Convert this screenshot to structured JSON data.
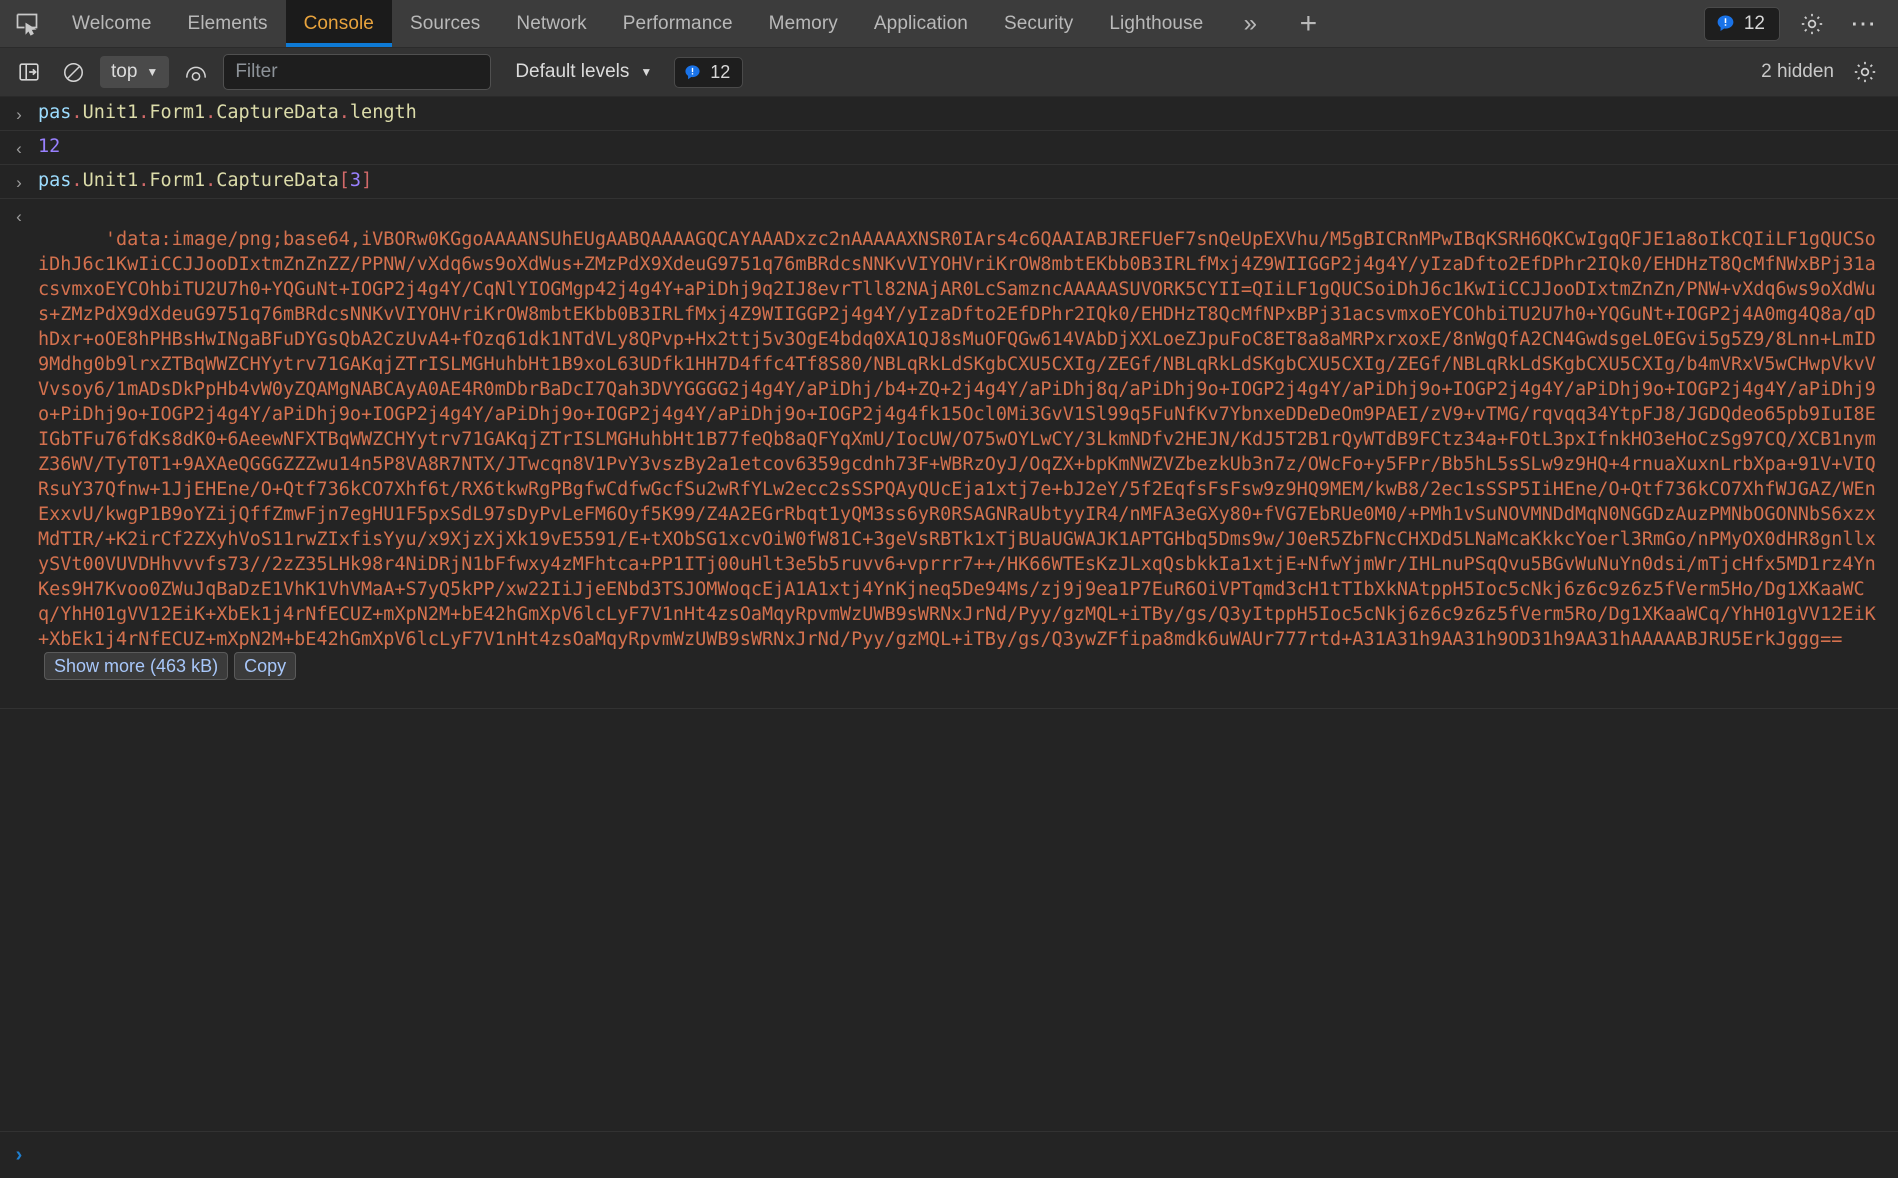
{
  "tabbar": {
    "inspect_icon": "inspect-element-icon",
    "tabs": [
      {
        "label": "Welcome",
        "selected": false
      },
      {
        "label": "Elements",
        "selected": false
      },
      {
        "label": "Console",
        "selected": true
      },
      {
        "label": "Sources",
        "selected": false
      },
      {
        "label": "Network",
        "selected": false
      },
      {
        "label": "Performance",
        "selected": false
      },
      {
        "label": "Memory",
        "selected": false
      },
      {
        "label": "Application",
        "selected": false
      },
      {
        "label": "Security",
        "selected": false
      },
      {
        "label": "Lighthouse",
        "selected": false
      }
    ],
    "more_tabs_label": "»",
    "add_tab_label": "+",
    "issues_count": "12",
    "settings_icon": "gear-icon",
    "more_options_icon": "dots-horizontal-icon",
    "accent_selected_tab": "#e8a33d",
    "accent_underline": "#0e7ad5"
  },
  "console_toolbar": {
    "sidebar_toggle_icon": "sidebar-toggle-icon",
    "clear_console_icon": "clear-console-icon",
    "context_selector": "top",
    "live_expression_icon": "eye-icon",
    "filter_placeholder": "Filter",
    "filter_value": "",
    "levels_label": "Default levels",
    "issues_count": "12",
    "hidden_label": "2 hidden",
    "settings_icon": "gear-icon"
  },
  "console": {
    "entries": [
      {
        "kind": "command",
        "gutter": "›",
        "tokens": [
          {
            "t": "ident",
            "v": "pas"
          },
          {
            "t": "dot",
            "v": "."
          },
          {
            "t": "prop",
            "v": "Unit1"
          },
          {
            "t": "dot",
            "v": "."
          },
          {
            "t": "prop",
            "v": "Form1"
          },
          {
            "t": "dot",
            "v": "."
          },
          {
            "t": "prop",
            "v": "CaptureData"
          },
          {
            "t": "dot",
            "v": "."
          },
          {
            "t": "prop",
            "v": "length"
          }
        ],
        "text": "pas.Unit1.Form1.CaptureData.length"
      },
      {
        "kind": "result",
        "gutter": "‹",
        "value_type": "number",
        "text": "12"
      },
      {
        "kind": "command",
        "gutter": "›",
        "tokens": [
          {
            "t": "ident",
            "v": "pas"
          },
          {
            "t": "dot",
            "v": "."
          },
          {
            "t": "prop",
            "v": "Unit1"
          },
          {
            "t": "dot",
            "v": "."
          },
          {
            "t": "prop",
            "v": "Form1"
          },
          {
            "t": "dot",
            "v": "."
          },
          {
            "t": "prop",
            "v": "CaptureData"
          },
          {
            "t": "brk",
            "v": "["
          },
          {
            "t": "num",
            "v": "3"
          },
          {
            "t": "brk",
            "v": "]"
          }
        ],
        "text": "pas.Unit1.Form1.CaptureData[3]"
      },
      {
        "kind": "result",
        "gutter": "‹",
        "value_type": "string",
        "show_more_label": "Show more (463 kB)",
        "copy_label": "Copy",
        "lines": [
          "'data:image/png;base64,iVBORw0KGgoAAAANSUhEUgAABQAAAAGQCAYAAADxzc2nAAAAAXNSR0IArs4c6QAAIABJREFUeF7snQeUpEXVhu/M5gBICRnMPwIBqKSRH6QKCwIgqQFJE1a8oIkCQIiLF1gQUCSoiDhJ6c1KwIiCCJJooDIxtmZnZnZZ/PPNW/vXdq6ws9oXdWus+ZMzPdX9XdeuG9751q76mBRdcsNNKvVIYOHVriKrOW8mbtEKbb0B3IRLfMxj4Z9WIIGGP2j4g4Y/yIzaDfto2EfDPhr2IQk0/EHDHzT8QcMfNWxBPj31acsvmxoEYCOhbiTU2U7h0+YQGuNt+IOGP2j4g4Y/CqNlYIOGMgp42j4g4Y+aPiDhj9q2IJ8evrTll82NAjAR0LcSamzncAAAAASUVORK5CYII=",
          "QIiLF1gQUCSoiDhJ6c1KwIiCCJJooDIxtmZnZn/PNW+vXdq6ws9oXdWus+ZMzPdX9dXdeuG9751q76mBRdcsNNKvVIYOHVriKrOW8mbtEKbb0B3IRLfMxj4Z9WIIGGP2j4g4Y/yIzaD",
          "fto2EfDPhr2IQk0/EHDHzT8QcMfNPxBPj31acsvmxoEYCOhbiTU2U7h0+YQGuNt+IOGP2j4A0mg4Q8a/qDhDxr+oOE8hPHBsHwINgaBFuDYGsQbA2CzUvA4+fOzq61dk1NTdVLy8QPvp+Hx2ttj",
          "5v3OgE4bdq0XA1QJ8sMuOFQGw614VAbDjXXLoeZJpuFoC8ET8a8aMRPxrxoxE/8nWgQfA2CN4GwdsgeL0EGvi5g5Z9/8Lnn+LmID9Mdhg0b9lrxZTBqWWZCHYytrv71GAKqjZTrISLMGHuhbHt1B",
          "9xoL63UDfk1HH7D4ffc4Tf8S80/NBLqRkLdSKgbCXU5CXIg/ZEGf/NBLqRkLdSKgbCXU5CXIg/ZEGf/NBLqRkLdSKgbCXU5CXIg/b4mVRxV5wCHwpVkvVVvsoy6/1mADsDkPpHb4vW0yZQAMgNABCAyA0AE4R0mDbrBaDcI7Qah3DVYGGGG",
          "2j4g4Y/aPiDhj/b4+ZQ+2j4g4Y/aPiDhj8q/aPiDhj9o+IOGP2j4g4Y/aPiDhj9o+IOGP2j4g4Y/aPiDhj9o+IOGP2j4g4Y/aPiDhj9o+PiDhj9o+IOGP2j4g4Y/aPiDhj9o+IOGP2j4g4Y/aPiDhj9o+IOGP2j4g4Y/aPiDhj9o+IOGP2j4g4",
          "fk15Ocl0Mi3GvV1Sl99q5FuNfKv7YbnxeDDeDeOm9PAEI/zV9+vTMG/rqvqq34YtpFJ8/JGDQdeo65pb9IuI8EIGbTFu76fdKs8dK0+6AeewNFXTBqWWZCHYytrv71GAKqjZTrISLMGHuhbHt1B",
          "77feQb8aQFYqXmU/IocUW/O75wOYLwCY/3LkmNDfv2HEJN/KdJ5T2B1rQyWTdB9FCtz34a+FOtL3pxIfnkHO3eHoCzSg97CQ/XCB1nymZ36WV/TyT0T1+9AXAeQGGGZZZwu14n5P8VA8R7NTX/JTwcqn8",
          "V1PvY3vszBy2a1etcov6359gcdnh73F+WBRzOyJ/OqZX+bpKmNWZVZbezkUb3n7z/OWcFo+y5FPr/Bb5hL5sSLw9z9HQ+4rnuaXuxnLrbXpa+91V+VIQRsuY37Qfnw+1JjEHEne/O+Qtf736kCO7Xhf",
          "6t/RX6tkwRgPBgfwCdfwGcfSu2wRfYLw2ecc2sSSPQAyQUcEja1xtj7e+bJ2eY/5f2EqfsFsFsw9z9HQ9MEM/kwB8/2ec1sSSP5IiHEne/O+Qtf736kCO7XhfWJGAZ/WEnExxvU/kwgP1B9oYZi",
          "jQffZmwFjn7egHU1F5pxSdL97sDyPvLeFM6Oyf5K99/Z4A2EGrRbqt1yQM3ss6yR0RSAGNRaUbtyyIR4/nMFA3eGXy80+fVG7EbRUe0M0/+PMh1vSuNOVMNDdMqN0NGGDzAuzPMNbOGONNbS6xzxMdTI",
          "R/+K2irCf2ZXyhVoS11rwZIxfisYyu/x9XjzXjXk19vE5591/E+tXObSG1xcvOiW0fW81C+3geVsRBTk1xTjBUaUGWAJK1APTGHbq5Dms9w/J0eR5ZbFNcCHXDd5LNaMcaKkkcYoerl3RmGo/nPMyO",
          "X0dHR8gnllxySVt00VUVDHhvvvfs73//2zZ35LHk98r4NiDRjN1bFfwxy4zMFhtca+PP1ITj00uHlt3e5b5ruvv6+vprrr7++/HK66WTEsKzJLxqQsbkkIa1xtjE+NfwYjmWr/IHLnuPSqQvu5BGv",
          "WuNuYn0dsi/mTjcHfx5MD1rz4YnKes9H7Kvoo0ZWuJqBaDzE1VhK1VhVMaA+S7yQ5kPP/xw22IiJjeENbd3TSJOMWoqcEjA1A1xtj4YnKjneq5De94Ms/zj9j9ea1P7EuR6OiVPTqmd3cH1tTIbXkNA",
          "tppH5Ioc5cNkj6z6c9z6z5fVerm5Ho/Dg1XKaaWCq/YhH01gVV12EiK+XbEk1j4rNfECUZ+mXpN2M+bE42hGmXpV6lcLyF7V1nHt4zsOaMqyRpvmWzUWB9sWRNxJrNd/Pyy/gzMQL+iTBy/gs/Q3y",
          "ItppH5Ioc5cNkj6z6c9z6z5fVerm5Ro/Dg1XKaaWCq/YhH01gVV12EiK+XbEk1j4rNfECUZ+mXpN2M+bE42hGmXpV6lcLyF7V1nHt4zsOaMqyRpvmWzUWB9sWRNxJrNd/Pyy/gzMQL+iTBy/gs/Q3y",
          "wZFfipa8mdk6uWAUr777rtd+A31A31h9AA31h9OD31h9AA31hAAAAABJRU5ErkJggg=="
        ]
      }
    ],
    "prompt": {
      "chevron": "›",
      "value": ""
    }
  }
}
